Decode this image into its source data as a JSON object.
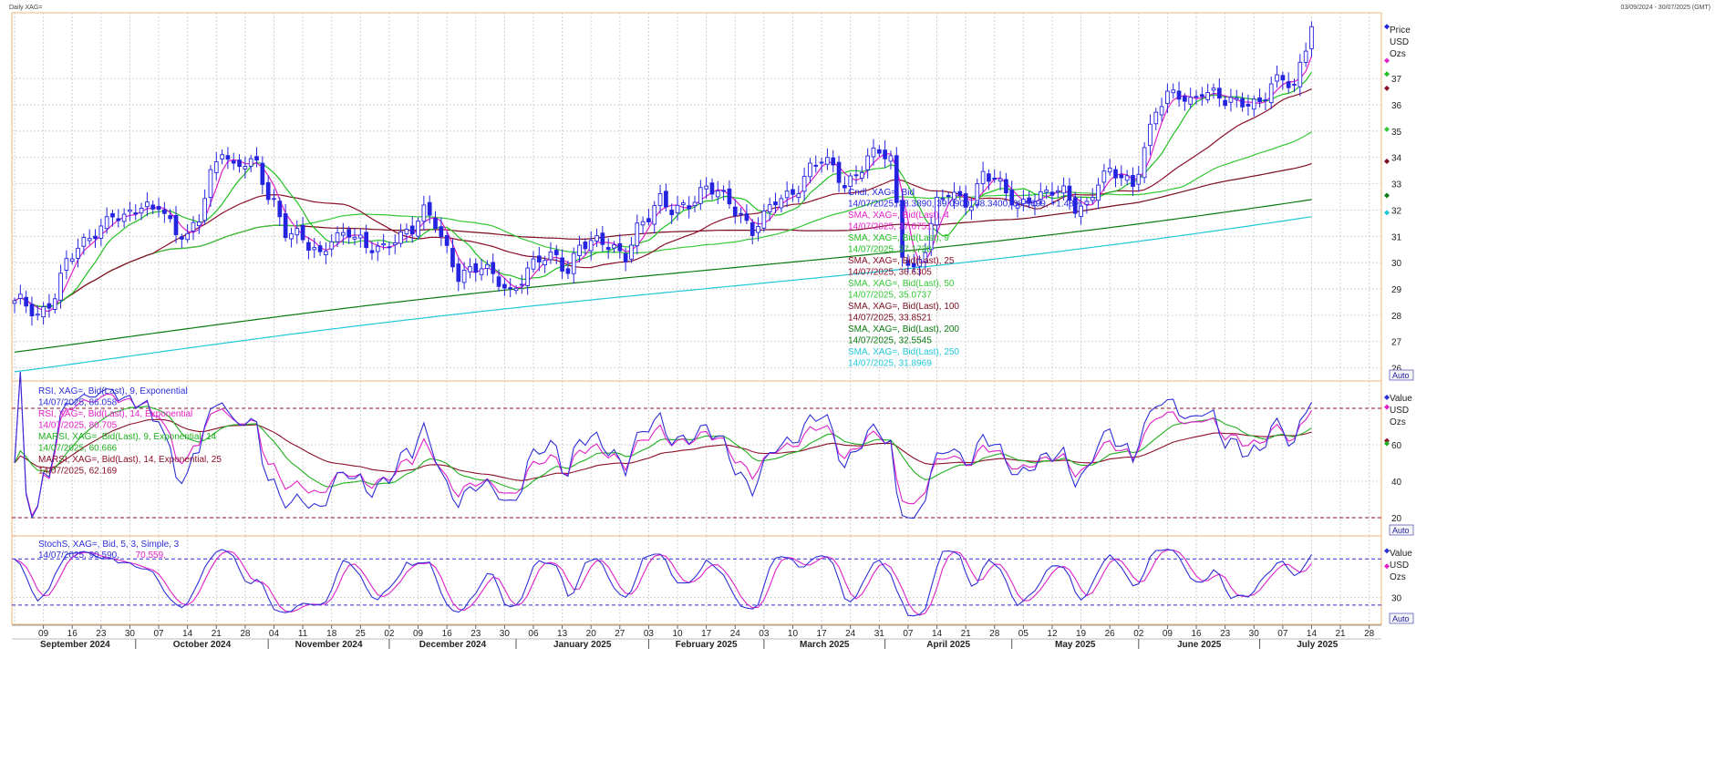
{
  "header": {
    "title": "Daily XAG=",
    "date_range": "03/09/2024 - 30/07/2025 (GMT)"
  },
  "colors": {
    "price_up": "#ffffff",
    "price_down": "#2424e0",
    "sma4": "#e020c8",
    "sma9": "#20c020",
    "sma25": "#8b0f2a",
    "sma50": "#36c836",
    "sma100": "#7a0c20",
    "sma200": "#0a7a10",
    "sma250": "#20c8d8",
    "rsi9": "#2f2fd8",
    "rsi14": "#e020c8",
    "marsi9": "#20b020",
    "marsi14": "#8b0f2a",
    "stoch_k": "#2f2fd8",
    "stoch_d": "#e020c8"
  },
  "chart_data": [
    {
      "type": "candlestick",
      "panel": "price",
      "axis_title": [
        "Price",
        "USD",
        "Ozs"
      ],
      "axis_button": "Auto",
      "ylim": [
        25.5,
        39.5
      ],
      "yticks": [
        26,
        27,
        28,
        29,
        30,
        31,
        32,
        33,
        34,
        35,
        36,
        37
      ],
      "grid": true,
      "x_tick_labels": [
        "09",
        "16",
        "23",
        "30",
        "07",
        "14",
        "21",
        "28",
        "04",
        "11",
        "18",
        "25",
        "02",
        "09",
        "16",
        "23",
        "30",
        "06",
        "13",
        "20",
        "27",
        "03",
        "10",
        "17",
        "24",
        "03",
        "10",
        "17",
        "24",
        "31",
        "07",
        "14",
        "21",
        "28",
        "05",
        "12",
        "19",
        "26",
        "02",
        "09",
        "16",
        "23",
        "30",
        "07",
        "14",
        "21",
        "28"
      ],
      "month_labels": [
        "September 2024",
        "October 2024",
        "November 2024",
        "December 2024",
        "January 2025",
        "February 2025",
        "March 2025",
        "April 2025",
        "May 2025",
        "June 2025",
        "July 2025"
      ],
      "close_anchors": [
        [
          "2024-09-03",
          28.4
        ],
        [
          "2024-09-06",
          28.0
        ],
        [
          "2024-09-11",
          28.9
        ],
        [
          "2024-09-13",
          30.0
        ],
        [
          "2024-09-18",
          30.6
        ],
        [
          "2024-09-20",
          31.2
        ],
        [
          "2024-09-25",
          32.0
        ],
        [
          "2024-09-27",
          31.6
        ],
        [
          "2024-10-02",
          32.0
        ],
        [
          "2024-10-04",
          32.1
        ],
        [
          "2024-10-07",
          32.4
        ],
        [
          "2024-10-10",
          31.2
        ],
        [
          "2024-10-14",
          30.8
        ],
        [
          "2024-10-16",
          31.6
        ],
        [
          "2024-10-18",
          33.4
        ],
        [
          "2024-10-22",
          34.5
        ],
        [
          "2024-10-24",
          33.6
        ],
        [
          "2024-10-28",
          33.7
        ],
        [
          "2024-10-30",
          33.6
        ],
        [
          "2024-11-01",
          32.6
        ],
        [
          "2024-11-04",
          32.4
        ],
        [
          "2024-11-06",
          31.3
        ],
        [
          "2024-11-08",
          31.0
        ],
        [
          "2024-11-12",
          30.5
        ],
        [
          "2024-11-14",
          30.2
        ],
        [
          "2024-11-18",
          31.1
        ],
        [
          "2024-11-21",
          31.2
        ],
        [
          "2024-11-26",
          30.4
        ],
        [
          "2024-11-29",
          30.6
        ],
        [
          "2024-12-03",
          31.1
        ],
        [
          "2024-12-06",
          31.2
        ],
        [
          "2024-12-10",
          31.8
        ],
        [
          "2024-12-12",
          31.5
        ],
        [
          "2024-12-16",
          30.6
        ],
        [
          "2024-12-18",
          29.6
        ],
        [
          "2024-12-20",
          29.6
        ],
        [
          "2024-12-24",
          29.7
        ],
        [
          "2024-12-27",
          29.4
        ],
        [
          "2024-12-31",
          29.0
        ],
        [
          "2025-01-03",
          29.6
        ],
        [
          "2025-01-07",
          30.0
        ],
        [
          "2025-01-10",
          30.3
        ],
        [
          "2025-01-14",
          29.8
        ],
        [
          "2025-01-16",
          30.7
        ],
        [
          "2025-01-20",
          30.6
        ],
        [
          "2025-01-22",
          30.7
        ],
        [
          "2025-01-24",
          30.6
        ],
        [
          "2025-01-28",
          30.4
        ],
        [
          "2025-01-30",
          31.3
        ],
        [
          "2025-02-03",
          31.6
        ],
        [
          "2025-02-05",
          32.3
        ],
        [
          "2025-02-07",
          32.1
        ],
        [
          "2025-02-11",
          32.3
        ],
        [
          "2025-02-13",
          32.4
        ],
        [
          "2025-02-17",
          32.7
        ],
        [
          "2025-02-19",
          32.6
        ],
        [
          "2025-02-21",
          32.4
        ],
        [
          "2025-02-25",
          31.9
        ],
        [
          "2025-02-27",
          31.2
        ],
        [
          "2025-03-03",
          31.6
        ],
        [
          "2025-03-05",
          32.3
        ],
        [
          "2025-03-07",
          32.6
        ],
        [
          "2025-03-11",
          33.0
        ],
        [
          "2025-03-13",
          33.6
        ],
        [
          "2025-03-17",
          33.8
        ],
        [
          "2025-03-19",
          33.5
        ],
        [
          "2025-03-21",
          33.0
        ],
        [
          "2025-03-25",
          33.5
        ],
        [
          "2025-03-27",
          34.0
        ],
        [
          "2025-03-31",
          34.1
        ],
        [
          "2025-04-02",
          33.8
        ],
        [
          "2025-04-04",
          30.5
        ],
        [
          "2025-04-08",
          29.8
        ],
        [
          "2025-04-10",
          30.6
        ],
        [
          "2025-04-14",
          32.1
        ],
        [
          "2025-04-16",
          32.6
        ],
        [
          "2025-04-18",
          32.5
        ],
        [
          "2025-04-22",
          32.4
        ],
        [
          "2025-04-24",
          33.4
        ],
        [
          "2025-04-28",
          33.0
        ],
        [
          "2025-04-30",
          32.6
        ],
        [
          "2025-05-02",
          32.2
        ],
        [
          "2025-05-06",
          32.6
        ],
        [
          "2025-05-08",
          32.5
        ],
        [
          "2025-05-12",
          32.6
        ],
        [
          "2025-05-14",
          32.6
        ],
        [
          "2025-05-16",
          32.2
        ],
        [
          "2025-05-20",
          32.3
        ],
        [
          "2025-05-22",
          33.1
        ],
        [
          "2025-05-26",
          33.3
        ],
        [
          "2025-05-28",
          33.2
        ],
        [
          "2025-05-30",
          33.0
        ],
        [
          "2025-06-03",
          34.5
        ],
        [
          "2025-06-05",
          35.8
        ],
        [
          "2025-06-09",
          36.2
        ],
        [
          "2025-06-11",
          36.3
        ],
        [
          "2025-06-13",
          36.2
        ],
        [
          "2025-06-17",
          36.7
        ],
        [
          "2025-06-19",
          36.4
        ],
        [
          "2025-06-23",
          36.0
        ],
        [
          "2025-06-25",
          36.0
        ],
        [
          "2025-06-27",
          36.2
        ],
        [
          "2025-07-01",
          36.2
        ],
        [
          "2025-07-03",
          36.8
        ],
        [
          "2025-07-07",
          36.8
        ],
        [
          "2025-07-09",
          36.6
        ],
        [
          "2025-07-11",
          38.3
        ],
        [
          "2025-07-14",
          38.97
        ]
      ],
      "legend": [
        {
          "line1": "Cndl, XAG=, Bid",
          "line2": "14/07/2025, 38.3890, 39.0900, 38.3400, 38.9699, +1.48%",
          "color_key": "price_down"
        },
        {
          "line1": "SMA, XAG=, Bid(Last), 4",
          "line2": "14/07/2025, 37.6751",
          "color_key": "sma4"
        },
        {
          "line1": "SMA, XAG=, Bid(Last), 9",
          "line2": "14/07/2025, 37.1720",
          "color_key": "sma9"
        },
        {
          "line1": "SMA, XAG=, Bid(Last), 25",
          "line2": "14/07/2025, 36.6305",
          "color_key": "sma25"
        },
        {
          "line1": "SMA, XAG=, Bid(Last), 50",
          "line2": "14/07/2025, 35.0737",
          "color_key": "sma50"
        },
        {
          "line1": "SMA, XAG=, Bid(Last), 100",
          "line2": "14/07/2025, 33.8521",
          "color_key": "sma100"
        },
        {
          "line1": "SMA, XAG=, Bid(Last), 200",
          "line2": "14/07/2025, 32.5545",
          "color_key": "sma200"
        },
        {
          "line1": "SMA, XAG=, Bid(Last), 250",
          "line2": "14/07/2025, 31.8969",
          "color_key": "sma250"
        }
      ],
      "sma200_range": [
        26.6,
        32.55
      ],
      "sma250_range": [
        25.85,
        31.9
      ]
    },
    {
      "type": "line",
      "panel": "rsi",
      "axis_title": [
        "Value",
        "USD",
        "Ozs"
      ],
      "axis_button": "Auto",
      "ylim": [
        10,
        95
      ],
      "yticks": [
        20,
        40,
        60
      ],
      "ref_lines": [
        80,
        20
      ],
      "legend": [
        {
          "line1": "RSI, XAG=, Bid(Last), 9, Exponential",
          "line2": "14/07/2025, 86.058",
          "color_key": "rsi9"
        },
        {
          "line1": "RSI, XAG=, Bid(Last), 14, Exponential",
          "line2": "14/07/2025, 80.705",
          "color_key": "rsi14"
        },
        {
          "line1": "MARSI, XAG=, Bid(Last), 9, Exponential, 14",
          "line2": "14/07/2025, 60.666",
          "color_key": "marsi9"
        },
        {
          "line1": "MARSI, XAG=, Bid(Last), 14, Exponential, 25",
          "line2": "14/07/2025, 62.169",
          "color_key": "marsi14"
        }
      ]
    },
    {
      "type": "line",
      "panel": "stochastic",
      "axis_title": [
        "Value",
        "USD",
        "Ozs"
      ],
      "axis_button": "Auto",
      "ylim": [
        -5,
        110
      ],
      "yticks": [
        30
      ],
      "ref_lines": [
        80,
        20
      ],
      "legend": [
        {
          "line1": "StochS, XAG=, Bid, 5, 3, Simple, 3",
          "line2": "",
          "color_key": "stoch_k"
        }
      ],
      "legend_values": [
        {
          "text": "14/07/2025, 90.590,",
          "color_key": "stoch_k"
        },
        {
          "text": "70.559,",
          "color_key": "stoch_d"
        }
      ]
    }
  ]
}
